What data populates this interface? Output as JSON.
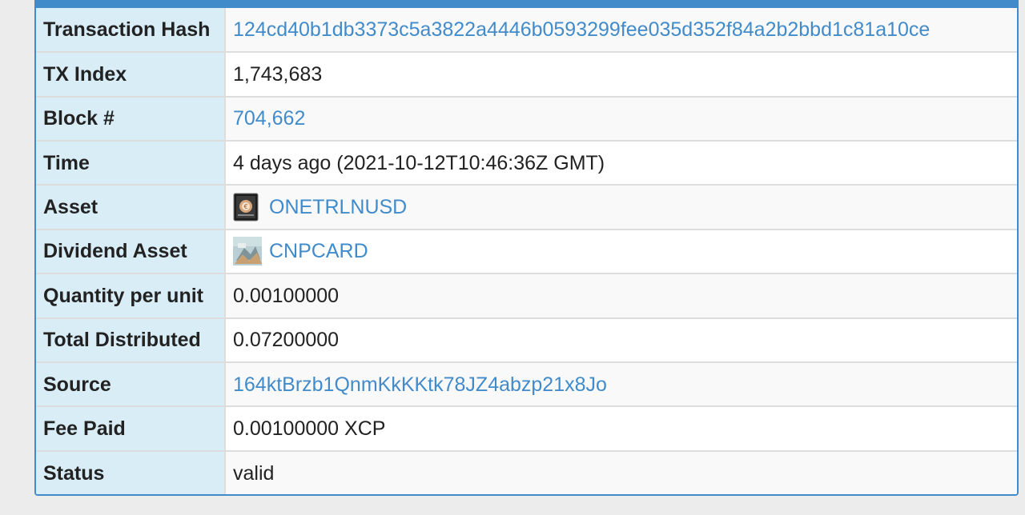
{
  "colors": {
    "accent": "#428bca",
    "label_bg": "#d9edf7",
    "row_alt_bg": "#f9f9f9",
    "page_bg": "#ececec"
  },
  "rows": {
    "tx_hash": {
      "label": "Transaction Hash",
      "value": "124cd40b1db3373c5a3822a4446b0593299fee035d352f84a2b2bbd1c81a10ce"
    },
    "tx_index": {
      "label": "TX Index",
      "value": "1,743,683"
    },
    "block": {
      "label": "Block #",
      "value": "704,662"
    },
    "time": {
      "label": "Time",
      "value": "4 days ago (2021-10-12T10:46:36Z GMT)"
    },
    "asset": {
      "label": "Asset",
      "value": "ONETRLNUSD",
      "icon": "onetrlnusd-card-icon"
    },
    "dividend_asset": {
      "label": "Dividend Asset",
      "value": "CNPCARD",
      "icon": "cnpcard-card-icon"
    },
    "quantity_per_unit": {
      "label": "Quantity per unit",
      "value": "0.00100000"
    },
    "total_distributed": {
      "label": "Total Distributed",
      "value": "0.07200000"
    },
    "source": {
      "label": "Source",
      "value": "164ktBrzb1QnmKkKKtk78JZ4abzp21x8Jo"
    },
    "fee_paid": {
      "label": "Fee Paid",
      "value": "0.00100000 XCP"
    },
    "status": {
      "label": "Status",
      "value": "valid"
    }
  }
}
